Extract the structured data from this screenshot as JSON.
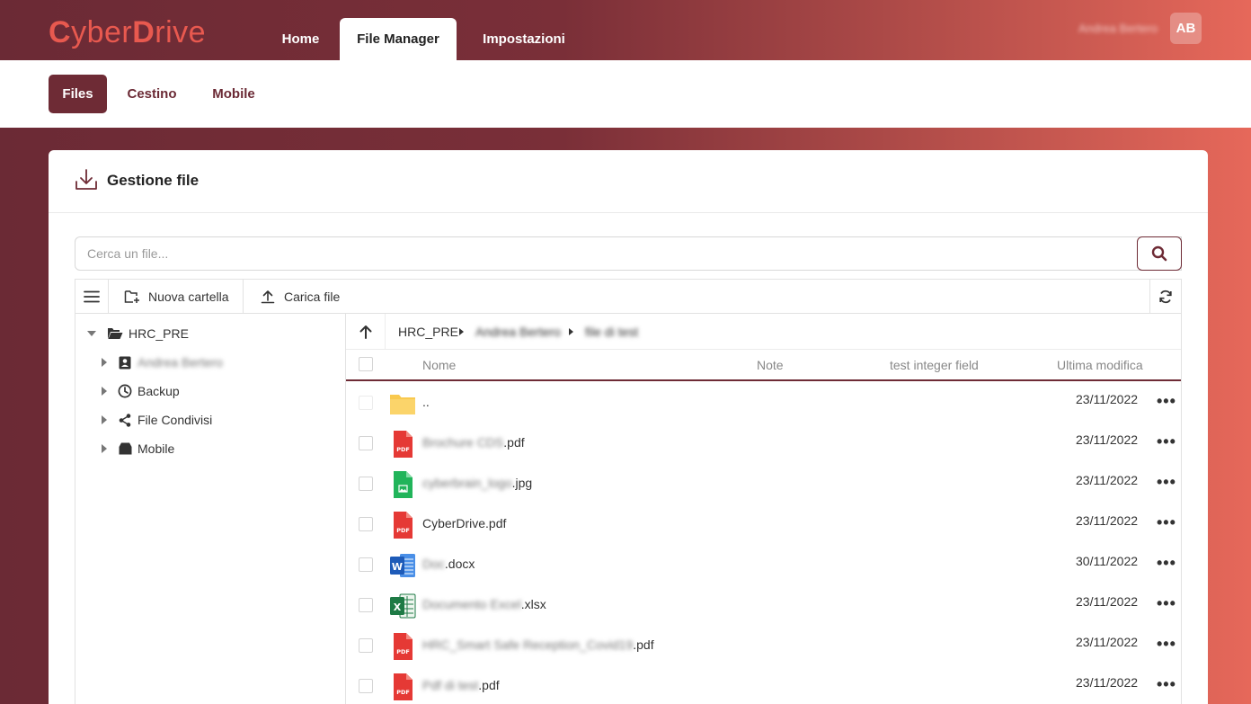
{
  "header": {
    "logo_c1": "C",
    "logo_p1": "yber",
    "logo_c2": "D",
    "logo_p2": "rive",
    "tabs": [
      {
        "label": "Home"
      },
      {
        "label": "File Manager"
      },
      {
        "label": "Impostazioni"
      }
    ],
    "user_name": "Andrea Bertero",
    "avatar_initials": "AB"
  },
  "subnav": {
    "tabs": [
      {
        "label": "Files"
      },
      {
        "label": "Cestino"
      },
      {
        "label": "Mobile"
      }
    ]
  },
  "card": {
    "title": "Gestione file",
    "search_placeholder": "Cerca un file..."
  },
  "toolbar": {
    "new_folder": "Nuova cartella",
    "upload": "Carica file"
  },
  "tree": {
    "root": "HRC_PRE",
    "children": [
      {
        "label": "Andrea Bertero",
        "icon": "user-badge-icon"
      },
      {
        "label": "Backup",
        "icon": "clock-icon"
      },
      {
        "label": "File Condivisi",
        "icon": "share-icon"
      },
      {
        "label": "Mobile",
        "icon": "archive-icon"
      }
    ]
  },
  "breadcrumb": [
    "HRC_PRE",
    "Andrea Bertero",
    "file di test"
  ],
  "table": {
    "columns": [
      "Nome",
      "Note",
      "test integer field",
      "Ultima modifica"
    ],
    "rows": [
      {
        "name_blur": "",
        "name_ext": "..",
        "type": "folder",
        "date": "23/11/2022"
      },
      {
        "name_blur": "Brochure CDS",
        "name_ext": ".pdf",
        "type": "pdf",
        "date": "23/11/2022"
      },
      {
        "name_blur": "cyberbrain_logo",
        "name_ext": ".jpg",
        "type": "image",
        "date": "23/11/2022"
      },
      {
        "name_blur": "",
        "name_ext": "CyberDrive.pdf",
        "type": "pdf",
        "date": "23/11/2022"
      },
      {
        "name_blur": "Doc",
        "name_ext": ".docx",
        "type": "word",
        "date": "30/11/2022"
      },
      {
        "name_blur": "Documento Excel",
        "name_ext": ".xlsx",
        "type": "excel",
        "date": "23/11/2022"
      },
      {
        "name_blur": "HRC_Smart Safe Reception_Covid19",
        "name_ext": ".pdf",
        "type": "pdf",
        "date": "23/11/2022"
      },
      {
        "name_blur": "Pdf di test",
        "name_ext": ".pdf",
        "type": "pdf",
        "date": "23/11/2022"
      }
    ]
  },
  "colors": {
    "brand": "#6e2b35",
    "accent": "#e8594f"
  }
}
